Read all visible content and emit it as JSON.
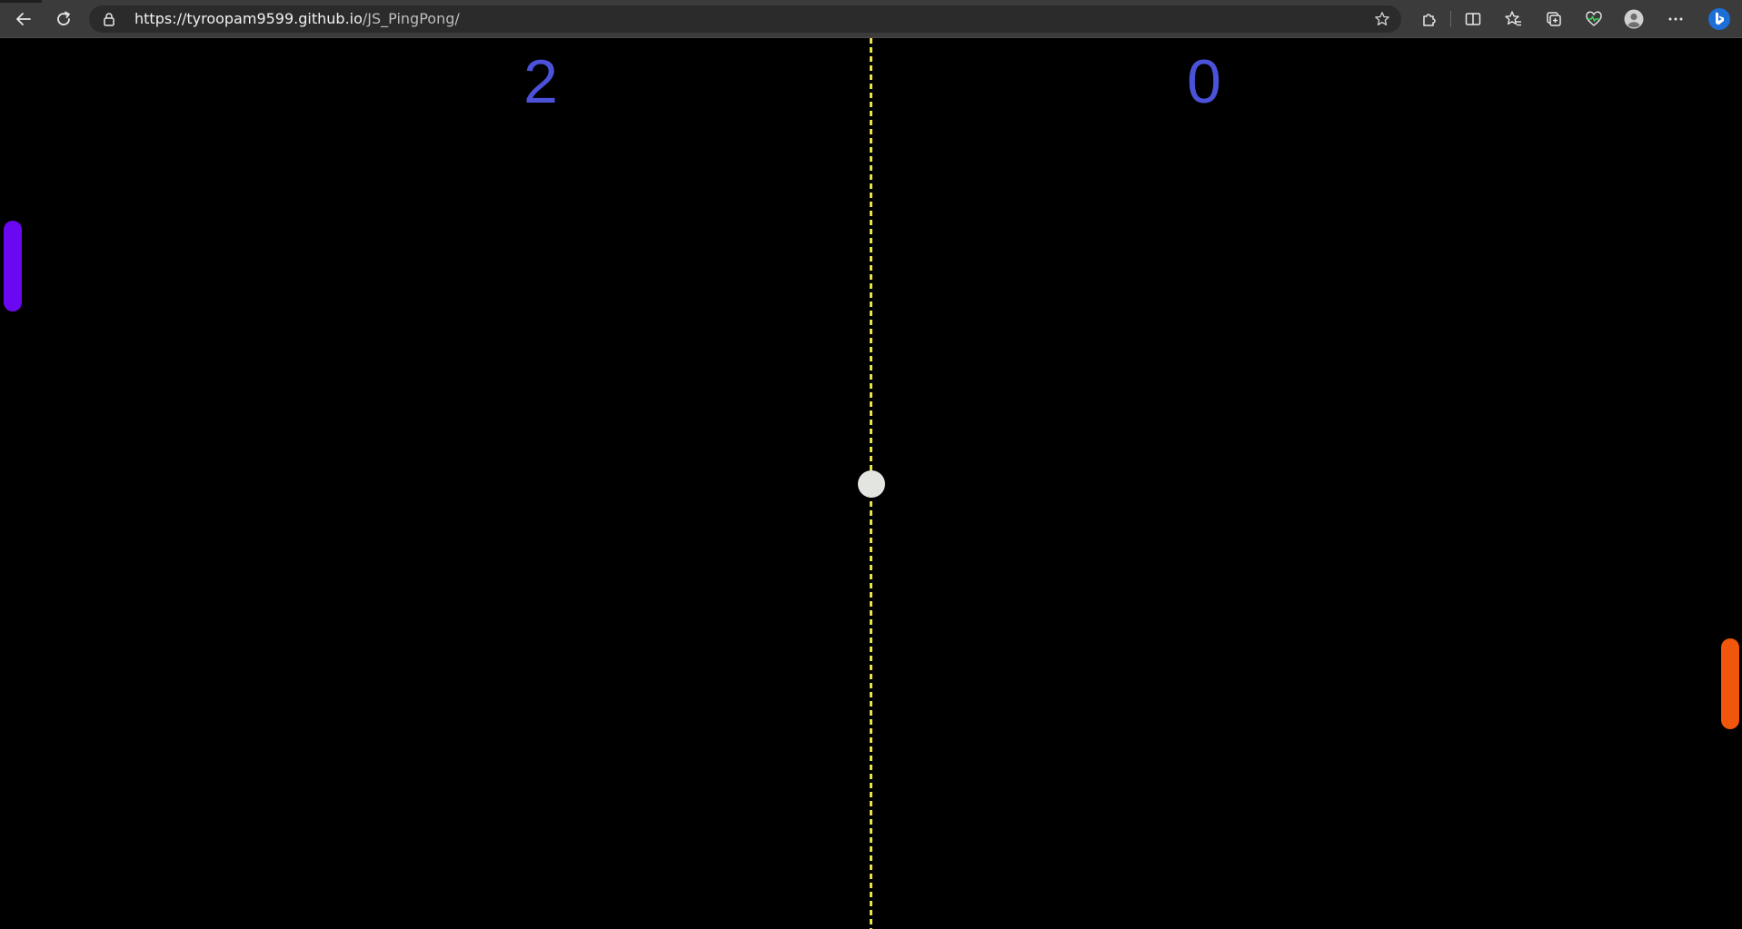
{
  "browser": {
    "url_host": "https://tyroopam9599.github.io",
    "url_path": "/JS_PingPong/",
    "icons": {
      "back": "back-arrow-icon",
      "reload": "reload-icon",
      "lock": "lock-icon",
      "favorite": "star-icon",
      "extensions": "extensions-icon",
      "split_screen": "split-screen-icon",
      "favorites": "favorites-icon",
      "collections": "collections-icon",
      "health": "heartbeat-icon",
      "profile": "profile-avatar-icon",
      "menu": "more-menu-icon",
      "copilot": "bing-copilot-icon"
    }
  },
  "game": {
    "left_score": "2",
    "right_score": "0",
    "colors": {
      "background": "#000000",
      "score": "#4b52d9",
      "net": "#e9e24a",
      "ball": "#e3e6e0",
      "left_paddle": "#6a08f2",
      "right_paddle": "#f0560c"
    }
  }
}
